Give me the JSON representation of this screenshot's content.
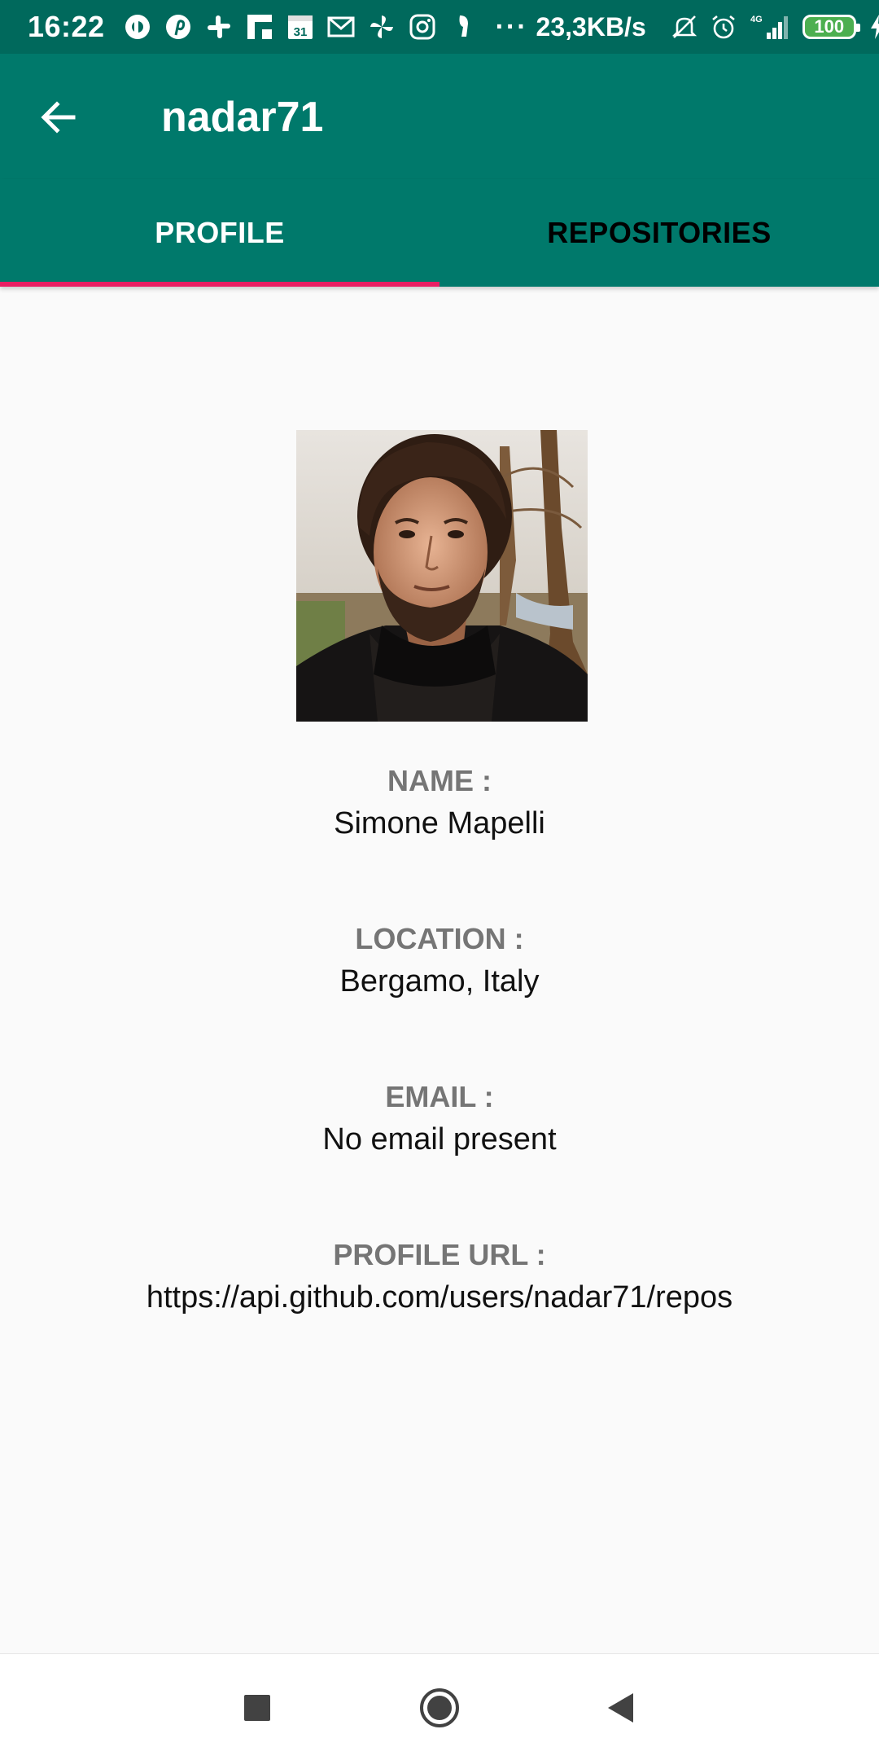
{
  "status_bar": {
    "time": "16:22",
    "more": "···",
    "net_speed": "23,3KB/s",
    "battery_level": "100",
    "notification_icons": [
      "dribbble-icon",
      "pinterest-icon",
      "slack-icon",
      "flipboard-icon",
      "calendar-icon",
      "gmail-icon",
      "pinwheel-icon",
      "instagram-icon",
      "incognito-icon"
    ],
    "calendar_day": "31",
    "network_type": "4G"
  },
  "app_bar": {
    "title": "nadar71"
  },
  "tabs": [
    {
      "label": "PROFILE",
      "selected": true
    },
    {
      "label": "REPOSITORIES",
      "selected": false
    }
  ],
  "profile": {
    "name_label": "NAME :",
    "name_value": "Simone Mapelli",
    "location_label": "LOCATION :",
    "location_value": "Bergamo, Italy",
    "email_label": "EMAIL :",
    "email_value": "No email present",
    "url_label": "PROFILE URL :",
    "url_value": "https://api.github.com/users/nadar71/repos"
  },
  "colors": {
    "status_bar": "#00695c",
    "primary": "#00796b",
    "tab_indicator": "#e91e63",
    "background": "#fafafa",
    "label_gray": "#757575"
  }
}
